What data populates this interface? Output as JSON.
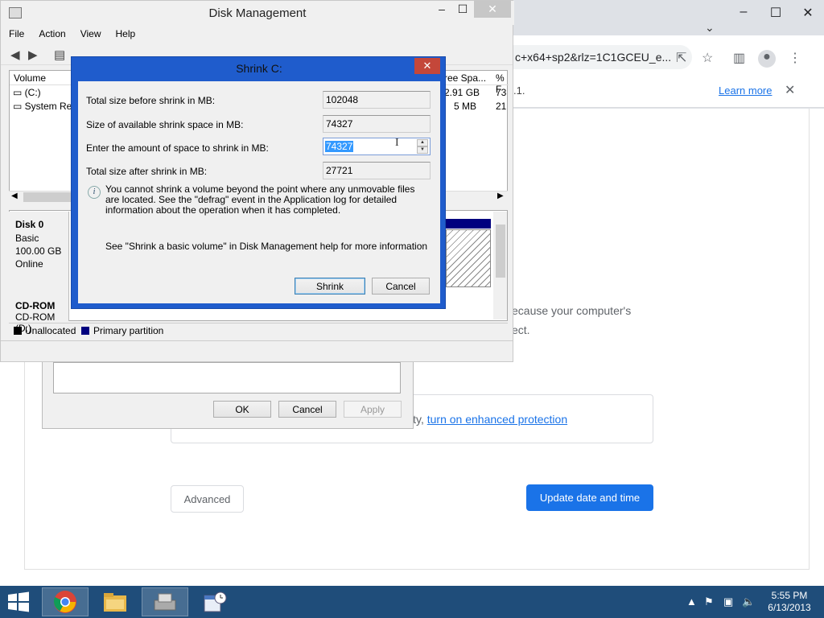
{
  "chrome": {
    "url_fragment": "c+x64+sp2&rlz=1C1GCEU_e...",
    "info_fragment": ".1.",
    "learn_more": "Learn more",
    "body_line1": "ecause your computer's",
    "body_line2": "ect.",
    "protect_prefix": "ity,",
    "protect_link": "turn on enhanced protection",
    "advanced_label": "Advanced",
    "update_label": "Update date and time"
  },
  "bg_dialog": {
    "ok": "OK",
    "cancel": "Cancel",
    "apply": "Apply"
  },
  "disk_mgmt": {
    "title": "Disk Management",
    "menu": [
      "File",
      "Action",
      "View",
      "Help"
    ],
    "columns": {
      "volume": "Volume",
      "free_space": "ree Spa...",
      "pct_free": "% F"
    },
    "rows": [
      {
        "volume": "(C:)",
        "free": "2.91 GB",
        "pct": "73"
      },
      {
        "volume": "System Res",
        "free": "5 MB",
        "pct": "21"
      }
    ],
    "disk0": {
      "name": "Disk 0",
      "type": "Basic",
      "size": "100.00 GB",
      "status": "Online"
    },
    "cdrom": {
      "name": "CD-ROM",
      "sub": "CD-ROM (D:)"
    },
    "legend": {
      "unallocated": "Unallocated",
      "primary": "Primary partition"
    },
    "colors": {
      "unallocated": "#000000",
      "primary": "#00007f"
    }
  },
  "shrink": {
    "title": "Shrink C:",
    "total_before_label": "Total size before shrink in MB:",
    "total_before_value": "102048",
    "available_label": "Size of available shrink space in MB:",
    "available_value": "74327",
    "amount_label": "Enter the amount of space to shrink in MB:",
    "amount_value": "74327",
    "total_after_label": "Total size after shrink in MB:",
    "total_after_value": "27721",
    "info_text": "You cannot shrink a volume beyond the point where any unmovable files are located. See the \"defrag\" event in the Application log for detailed information about the operation when it has completed.",
    "see_text": "See \"Shrink a basic volume\" in Disk Management help for more information",
    "shrink_button": "Shrink",
    "cancel_button": "Cancel"
  },
  "taskbar": {
    "apps": [
      "chrome-icon",
      "file-explorer-icon",
      "disk-management-icon",
      "date-time-icon"
    ],
    "time": "5:55 PM",
    "date": "6/13/2013"
  }
}
